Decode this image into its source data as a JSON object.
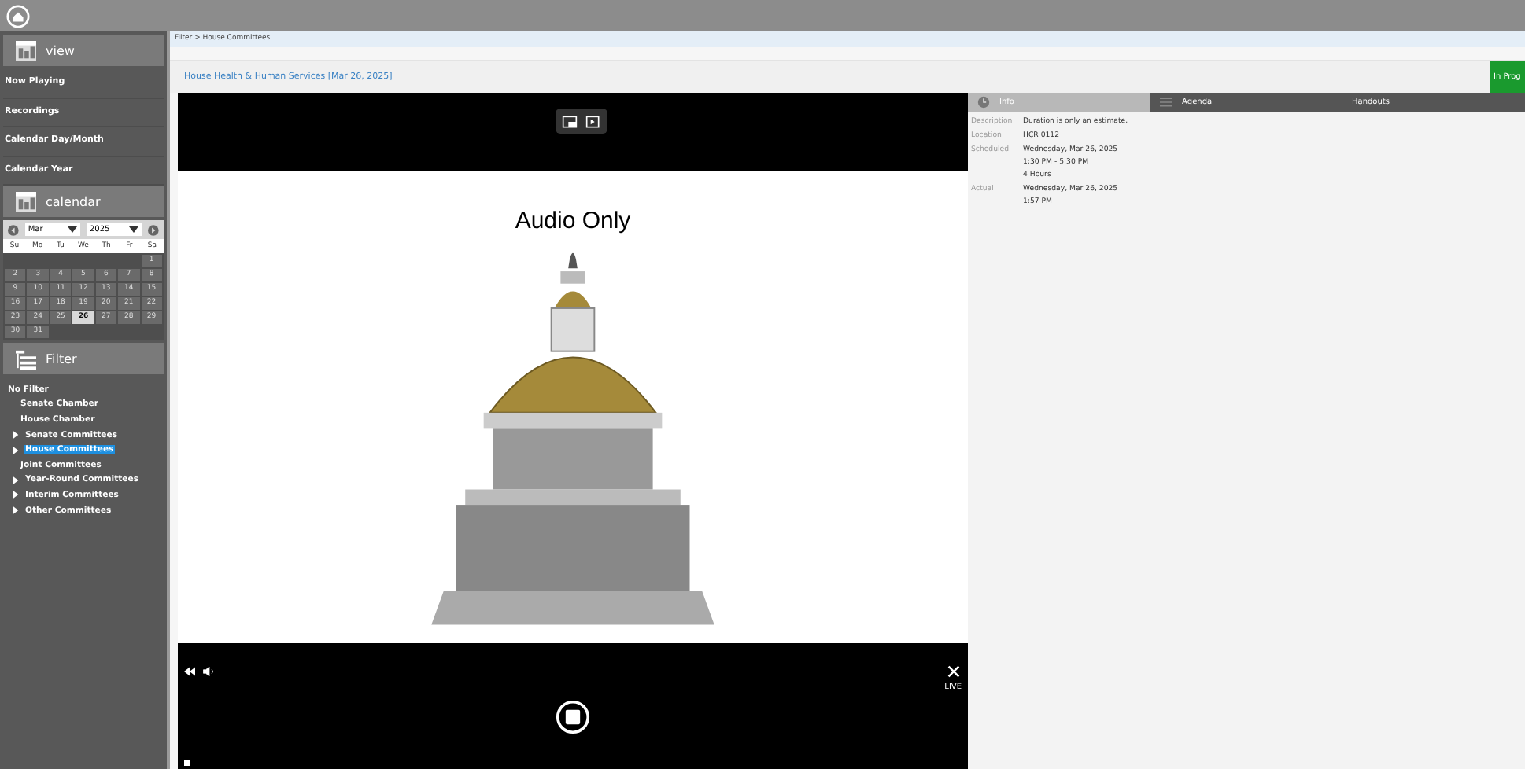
{
  "sidebar": {
    "sections": [
      {
        "kind": "menu",
        "title": "view",
        "items": [
          {
            "label": "Now Playing"
          },
          {
            "label": "Recordings"
          },
          {
            "label": "Calendar Day/Month"
          },
          {
            "label": "Calendar Year"
          }
        ]
      },
      {
        "kind": "calendar",
        "title": "calendar",
        "calendar": {
          "month": "Mar",
          "year": "2025",
          "weekdays": [
            "Su",
            "Mo",
            "Tu",
            "We",
            "Th",
            "Fr",
            "Sa"
          ],
          "weeks": [
            [
              {
                "day": "1",
                "selected": false
              }
            ],
            [
              {
                "day": "2",
                "selected": false
              },
              {
                "day": "3",
                "selected": false
              },
              {
                "day": "4",
                "selected": false
              },
              {
                "day": "5",
                "selected": false
              },
              {
                "day": "6",
                "selected": false
              },
              {
                "day": "7",
                "selected": false
              },
              {
                "day": "8",
                "selected": false
              }
            ],
            [
              {
                "day": "9",
                "selected": false
              },
              {
                "day": "10",
                "selected": false
              },
              {
                "day": "11",
                "selected": false
              },
              {
                "day": "12",
                "selected": false
              },
              {
                "day": "13",
                "selected": false
              },
              {
                "day": "14",
                "selected": false
              },
              {
                "day": "15",
                "selected": false
              }
            ],
            [
              {
                "day": "16",
                "selected": false
              },
              {
                "day": "17",
                "selected": false
              },
              {
                "day": "18",
                "selected": false
              },
              {
                "day": "19",
                "selected": false
              },
              {
                "day": "20",
                "selected": false
              },
              {
                "day": "21",
                "selected": false
              },
              {
                "day": "22",
                "selected": false
              }
            ],
            [
              {
                "day": "23",
                "selected": false
              },
              {
                "day": "24",
                "selected": false
              },
              {
                "day": "25",
                "selected": false
              },
              {
                "day": "26",
                "selected": true
              },
              {
                "day": "27",
                "selected": false
              },
              {
                "day": "28",
                "selected": false
              },
              {
                "day": "29",
                "selected": false
              }
            ],
            [
              {
                "day": "30",
                "selected": false
              },
              {
                "day": "31",
                "selected": false
              }
            ]
          ]
        }
      },
      {
        "kind": "filter",
        "title": "Filter",
        "filters": [
          {
            "label": "No Filter",
            "expandable": false,
            "selected": false,
            "children": [
              {
                "label": "Senate Chamber",
                "expandable": false,
                "selected": false
              },
              {
                "label": "House Chamber",
                "expandable": false,
                "selected": false
              },
              {
                "label": "Senate Committees",
                "expandable": true,
                "selected": false
              },
              {
                "label": "House Committees",
                "expandable": true,
                "selected": true
              },
              {
                "label": "Joint Committees",
                "expandable": false,
                "selected": false
              },
              {
                "label": "Year-Round Committees",
                "expandable": true,
                "selected": false
              },
              {
                "label": "Interim Committees",
                "expandable": true,
                "selected": false
              },
              {
                "label": "Other Committees",
                "expandable": true,
                "selected": false
              }
            ]
          }
        ]
      }
    ]
  },
  "breadcrumb": "Filter > House Committees",
  "event": {
    "title": "House Health & Human Services [Mar 26, 2025]",
    "status": "In Prog"
  },
  "player": {
    "overlay_text": "Audio Only",
    "live_label": "LIVE"
  },
  "details": {
    "tabs": [
      {
        "label": "Info",
        "selected": true
      },
      {
        "label": "Agenda",
        "selected": false
      },
      {
        "label": "Handouts",
        "selected": false
      }
    ],
    "rows": [
      {
        "label": "Description",
        "lines": [
          "Duration is only an estimate."
        ]
      },
      {
        "label": "Location",
        "lines": [
          "HCR 0112"
        ]
      },
      {
        "label": "Scheduled",
        "lines": [
          "Wednesday, Mar 26, 2025",
          "1:30 PM - 5:30 PM",
          "4 Hours"
        ]
      },
      {
        "label": "Actual",
        "lines": [
          "Wednesday, Mar 26, 2025",
          "1:57 PM"
        ]
      }
    ]
  }
}
